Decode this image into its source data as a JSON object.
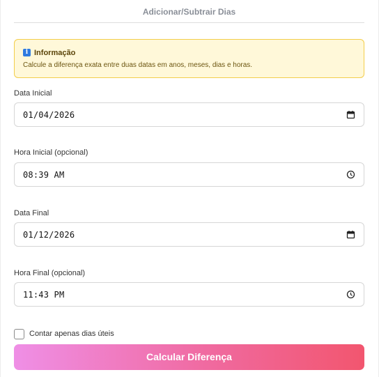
{
  "header": {
    "tab_label": "Adicionar/Subtrair Dias"
  },
  "info": {
    "icon": "info-icon",
    "title": "Informação",
    "text": "Calcule a diferença exata entre duas datas em anos, meses, dias e horas."
  },
  "fields": {
    "start_date": {
      "label": "Data Inicial",
      "value": "01/04/2026",
      "icon": "calendar-icon"
    },
    "start_time": {
      "label": "Hora Inicial (opcional)",
      "value": "08:39 AM",
      "icon": "clock-icon"
    },
    "end_date": {
      "label": "Data Final",
      "value": "01/12/2026",
      "icon": "calendar-icon"
    },
    "end_time": {
      "label": "Hora Final (opcional)",
      "value": "11:43 PM",
      "icon": "clock-icon"
    }
  },
  "options": {
    "business_days_label": "Contar apenas dias úteis",
    "business_days_checked": false
  },
  "actions": {
    "calculate_label": "Calcular Diferença"
  },
  "colors": {
    "info_bg": "#fff8d9",
    "info_border": "#f3cd4a",
    "info_icon": "#2f7be0",
    "button_gradient_start": "#ef8fe6",
    "button_gradient_end": "#f2566f"
  }
}
